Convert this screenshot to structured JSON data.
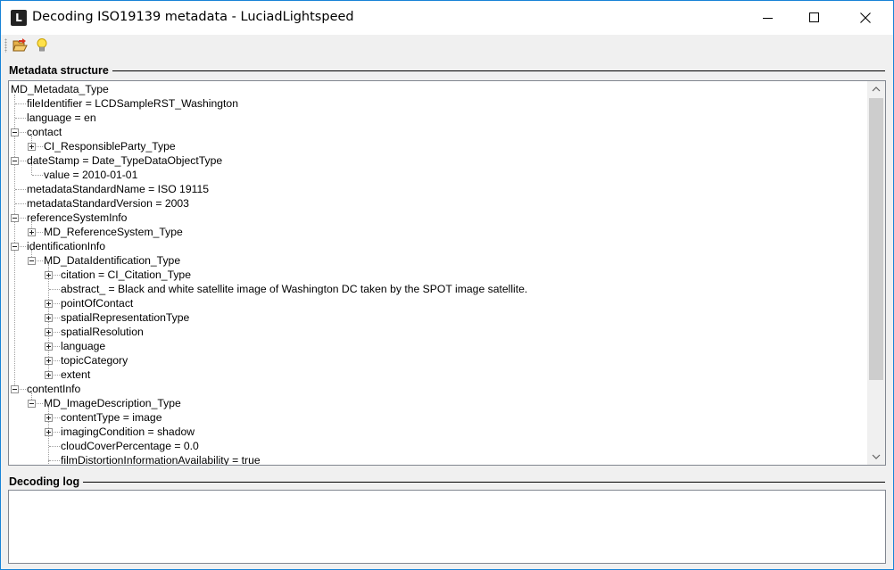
{
  "window": {
    "title": "Decoding ISO19139 metadata - LuciadLightspeed",
    "app_icon_letter": "L",
    "accent_color": "#1883d7"
  },
  "toolbar": {
    "open_icon": "folder-open-icon",
    "hint_icon": "lightbulb-icon"
  },
  "structure_section": {
    "title": "Metadata structure"
  },
  "log_section": {
    "title": "Decoding log",
    "content": ""
  },
  "tree": [
    {
      "text": "MD_Metadata_Type",
      "depth": 0,
      "toggle": "none"
    },
    {
      "text": "fileIdentifier = LCDSampleRST_Washington",
      "depth": 1,
      "toggle": "none"
    },
    {
      "text": "language = en",
      "depth": 1,
      "toggle": "none"
    },
    {
      "text": "contact",
      "depth": 1,
      "toggle": "minus"
    },
    {
      "text": "CI_ResponsibleParty_Type",
      "depth": 2,
      "toggle": "plus"
    },
    {
      "text": "dateStamp = Date_TypeDataObjectType",
      "depth": 1,
      "toggle": "minus"
    },
    {
      "text": "value = 2010-01-01",
      "depth": 2,
      "toggle": "none"
    },
    {
      "text": "metadataStandardName = ISO 19115",
      "depth": 1,
      "toggle": "none"
    },
    {
      "text": "metadataStandardVersion = 2003",
      "depth": 1,
      "toggle": "none"
    },
    {
      "text": "referenceSystemInfo",
      "depth": 1,
      "toggle": "minus"
    },
    {
      "text": "MD_ReferenceSystem_Type",
      "depth": 2,
      "toggle": "plus"
    },
    {
      "text": "identificationInfo",
      "depth": 1,
      "toggle": "minus"
    },
    {
      "text": "MD_DataIdentification_Type",
      "depth": 2,
      "toggle": "minus"
    },
    {
      "text": "citation = CI_Citation_Type",
      "depth": 3,
      "toggle": "plus"
    },
    {
      "text": "abstract_ = Black and white satellite image of Washington DC taken by the SPOT image satellite.",
      "depth": 3,
      "toggle": "none"
    },
    {
      "text": "pointOfContact",
      "depth": 3,
      "toggle": "plus"
    },
    {
      "text": "spatialRepresentationType",
      "depth": 3,
      "toggle": "plus"
    },
    {
      "text": "spatialResolution",
      "depth": 3,
      "toggle": "plus"
    },
    {
      "text": "language",
      "depth": 3,
      "toggle": "plus"
    },
    {
      "text": "topicCategory",
      "depth": 3,
      "toggle": "plus"
    },
    {
      "text": "extent",
      "depth": 3,
      "toggle": "plus"
    },
    {
      "text": "contentInfo",
      "depth": 1,
      "toggle": "minus"
    },
    {
      "text": "MD_ImageDescription_Type",
      "depth": 2,
      "toggle": "minus"
    },
    {
      "text": "contentType = image",
      "depth": 3,
      "toggle": "plus"
    },
    {
      "text": "imagingCondition = shadow",
      "depth": 3,
      "toggle": "plus"
    },
    {
      "text": "cloudCoverPercentage = 0.0",
      "depth": 3,
      "toggle": "none"
    },
    {
      "text": "filmDistortionInformationAvailability = true",
      "depth": 3,
      "toggle": "none"
    }
  ]
}
